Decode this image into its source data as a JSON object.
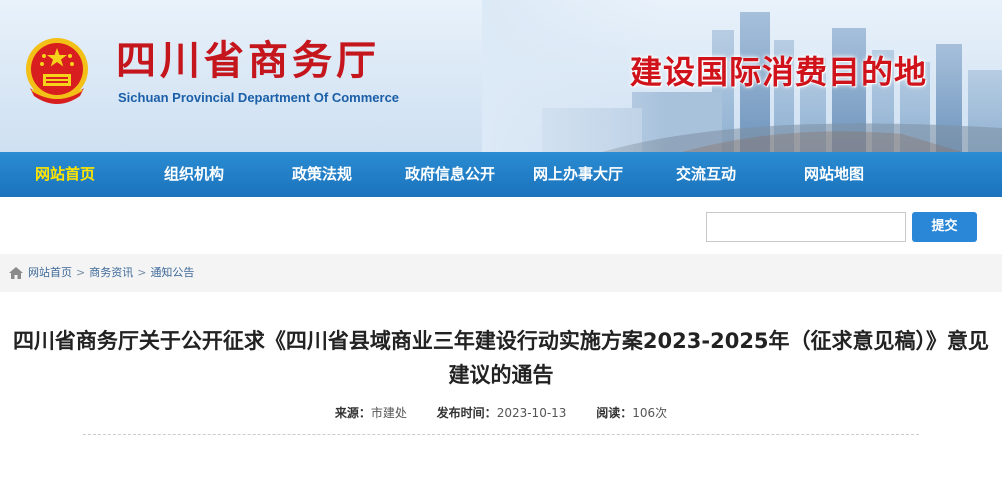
{
  "header": {
    "title": "四川省商务厅",
    "subtitle": "Sichuan Provincial Department Of Commerce",
    "slogan": "建设国际消费目的地"
  },
  "nav": {
    "items": [
      {
        "label": "网站首页",
        "active": true
      },
      {
        "label": "组织机构"
      },
      {
        "label": "政策法规"
      },
      {
        "label": "政府信息公开"
      },
      {
        "label": "网上办事大厅"
      },
      {
        "label": "交流互动"
      },
      {
        "label": "网站地图"
      }
    ]
  },
  "search": {
    "value": "",
    "submit_label": "提交"
  },
  "breadcrumb": {
    "items": [
      "网站首页",
      "商务资讯",
      "通知公告"
    ],
    "separator": ">"
  },
  "article": {
    "title": "四川省商务厅关于公开征求《四川省县域商业三年建设行动实施方案2023-2025年（征求意见稿）》意见建议的通告",
    "source_label": "来源：",
    "source_value": "市建处",
    "date_label": "发布时间：",
    "date_value": "2023-10-13",
    "views_label": "阅读：",
    "views_value": "106次"
  },
  "colors": {
    "brand_red": "#c4161c",
    "nav_blue": "#1b73bc",
    "nav_active": "#ffe400",
    "button_blue": "#2a86d6"
  },
  "icons": {
    "emblem": "national-emblem-icon",
    "home": "home-icon"
  }
}
